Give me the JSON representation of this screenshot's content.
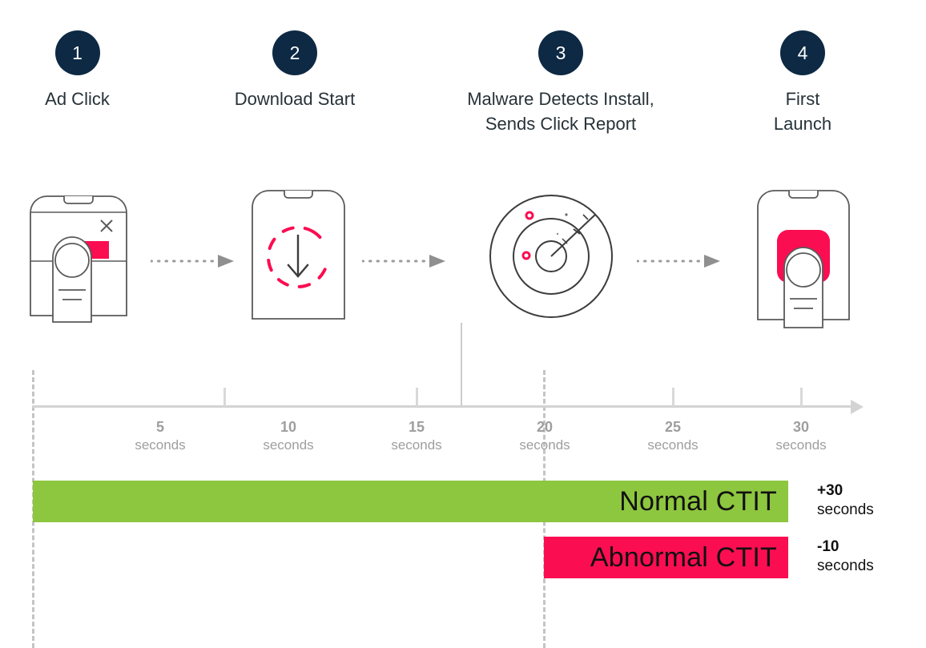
{
  "steps": [
    {
      "number": "1",
      "label": "Ad Click",
      "icon": "phone-ad-click-icon"
    },
    {
      "number": "2",
      "label": "Download Start",
      "icon": "phone-download-icon"
    },
    {
      "number": "3",
      "label": "Malware Detects Install,\nSends Click Report",
      "icon": "radar-detect-icon"
    },
    {
      "number": "4",
      "label": "First\nLaunch",
      "icon": "phone-first-launch-icon"
    }
  ],
  "connectors": [
    {
      "name": "connector-1-to-2"
    },
    {
      "name": "connector-2-to-3"
    },
    {
      "name": "connector-3-to-4"
    }
  ],
  "timeline": {
    "ticks": [
      {
        "num": "5",
        "unit": "seconds"
      },
      {
        "num": "10",
        "unit": "seconds"
      },
      {
        "num": "15",
        "unit": "seconds"
      },
      {
        "num": "20",
        "unit": "seconds"
      },
      {
        "num": "25",
        "unit": "seconds"
      },
      {
        "num": "30",
        "unit": "seconds"
      }
    ]
  },
  "bars": [
    {
      "name": "normal-ctit-bar",
      "label": "Normal CTIT",
      "color": "#8DC63F",
      "note_amount": "+30",
      "note_unit": "seconds"
    },
    {
      "name": "abnormal-ctit-bar",
      "label": "Abnormal CTIT",
      "color": "#FB0D51",
      "note_amount": "-10",
      "note_unit": "seconds"
    }
  ],
  "chart_data": {
    "type": "bar",
    "title": "",
    "xlabel": "seconds",
    "ylabel": "",
    "xlim": [
      0,
      32
    ],
    "grid": false,
    "orientation": "horizontal",
    "axis_ticks": [
      5,
      10,
      15,
      20,
      25,
      30
    ],
    "markers": [
      {
        "label": "Ad Click",
        "x": 0,
        "style": "dashed"
      },
      {
        "label": "Malware Detects Install, Sends Click Report",
        "x": 17,
        "style": "solid"
      },
      {
        "label": "First Launch",
        "x": 20,
        "style": "dashed"
      }
    ],
    "categories": [
      "Normal CTIT",
      "Abnormal CTIT"
    ],
    "series": [
      {
        "name": "Normal CTIT",
        "start": 0,
        "end": 29.5,
        "value": 30,
        "color": "#8DC63F"
      },
      {
        "name": "Abnormal CTIT",
        "start": 20,
        "end": 29.5,
        "value": 10,
        "color": "#FB0D51"
      }
    ],
    "annotations": [
      {
        "text": "+30 seconds",
        "series": "Normal CTIT"
      },
      {
        "text": "-10 seconds",
        "series": "Abnormal CTIT"
      }
    ]
  },
  "colors": {
    "circle_navy": "#0d2944",
    "green": "#8DC63F",
    "pink": "#FB0D51",
    "axis_grey": "#d3d3d3",
    "label_grey": "#9e9e9e",
    "stroke": "#5a5a5a"
  }
}
